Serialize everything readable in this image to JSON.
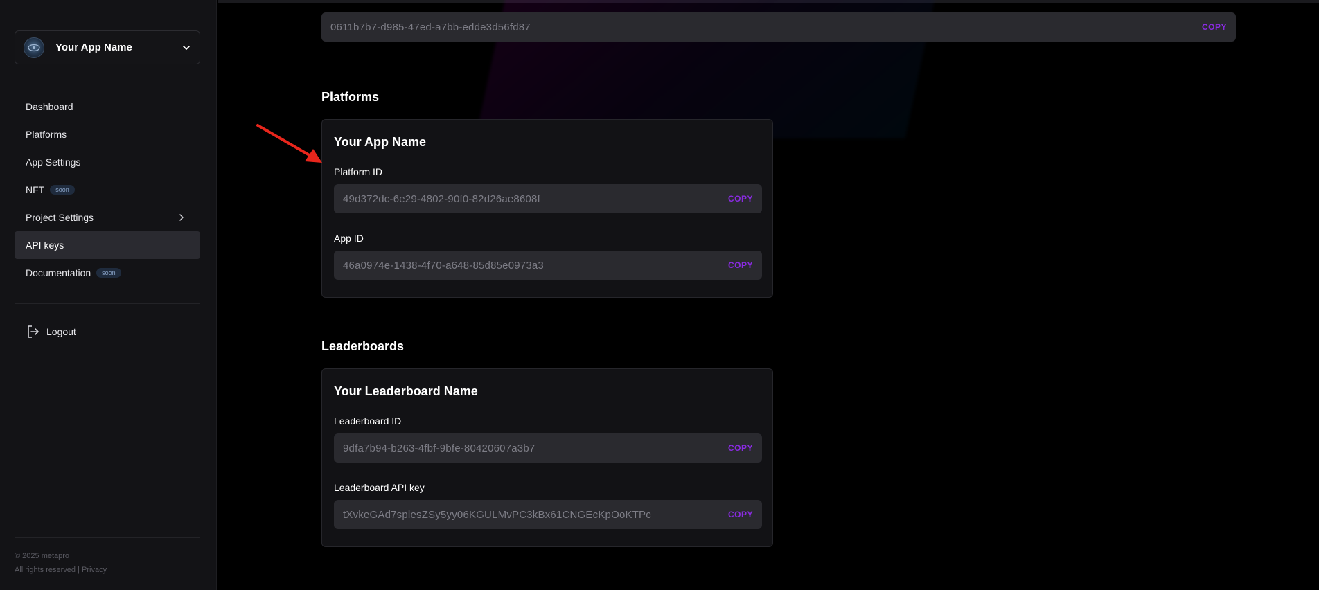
{
  "sidebar": {
    "app_name": "Your App Name",
    "nav": [
      {
        "label": "Dashboard"
      },
      {
        "label": "Platforms"
      },
      {
        "label": "App Settings"
      },
      {
        "label": "NFT",
        "badge": "soon"
      },
      {
        "label": "Project Settings"
      },
      {
        "label": "API keys",
        "active": true
      },
      {
        "label": "Documentation",
        "badge": "soon"
      }
    ],
    "logout_label": "Logout",
    "footer_line1": "© 2025 metapro",
    "footer_line2": "All rights reserved | Privacy"
  },
  "top_field": {
    "value": "0611b7b7-d985-47ed-a7bb-edde3d56fd87",
    "copy_label": "COPY"
  },
  "platforms": {
    "section_title": "Platforms",
    "card_title": "Your App Name",
    "fields": [
      {
        "label": "Platform ID",
        "value": "49d372dc-6e29-4802-90f0-82d26ae8608f",
        "copy_label": "COPY"
      },
      {
        "label": "App ID",
        "value": "46a0974e-1438-4f70-a648-85d85e0973a3",
        "copy_label": "COPY"
      }
    ]
  },
  "leaderboards": {
    "section_title": "Leaderboards",
    "card_title": "Your Leaderboard Name",
    "fields": [
      {
        "label": "Leaderboard ID",
        "value": "9dfa7b94-b263-4fbf-9bfe-80420607a3b7",
        "copy_label": "COPY"
      },
      {
        "label": "Leaderboard API key",
        "value": "tXvkeGAd7splesZSy5yy06KGULMvPC3kBx61CNGEcKpOoKTPc",
        "copy_label": "COPY"
      }
    ]
  },
  "colors": {
    "accent": "#8a2be2",
    "annotation_arrow": "#e8261c"
  }
}
